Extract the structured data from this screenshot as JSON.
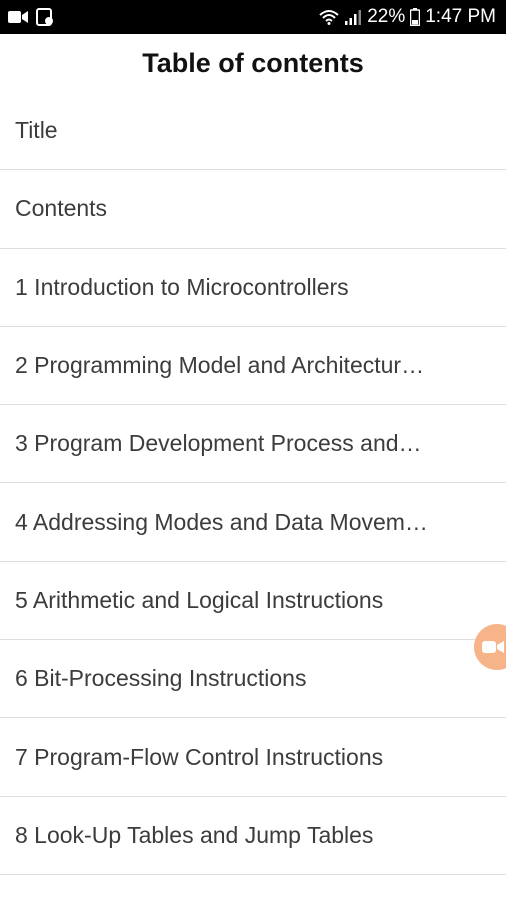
{
  "status_bar": {
    "battery": "22%",
    "time": "1:47 PM",
    "icons": [
      "video-camera-icon",
      "image-icon",
      "wifi-icon",
      "signal-icon",
      "battery-icon"
    ]
  },
  "header": {
    "title": "Table of contents"
  },
  "toc": [
    "Title",
    "Contents",
    "1 Introduction to Microcontrollers",
    "2 Programming Model and Architectur…",
    "3 Program Development Process and…",
    "4 Addressing Modes and Data Movem…",
    "5 Arithmetic and Logical Instructions",
    "6 Bit-Processing Instructions",
    "7 Program-Flow Control Instructions",
    "8 Look-Up Tables and Jump Tables"
  ],
  "floating_button": {
    "icon": "video-camera-icon",
    "color": "#f6b488"
  }
}
